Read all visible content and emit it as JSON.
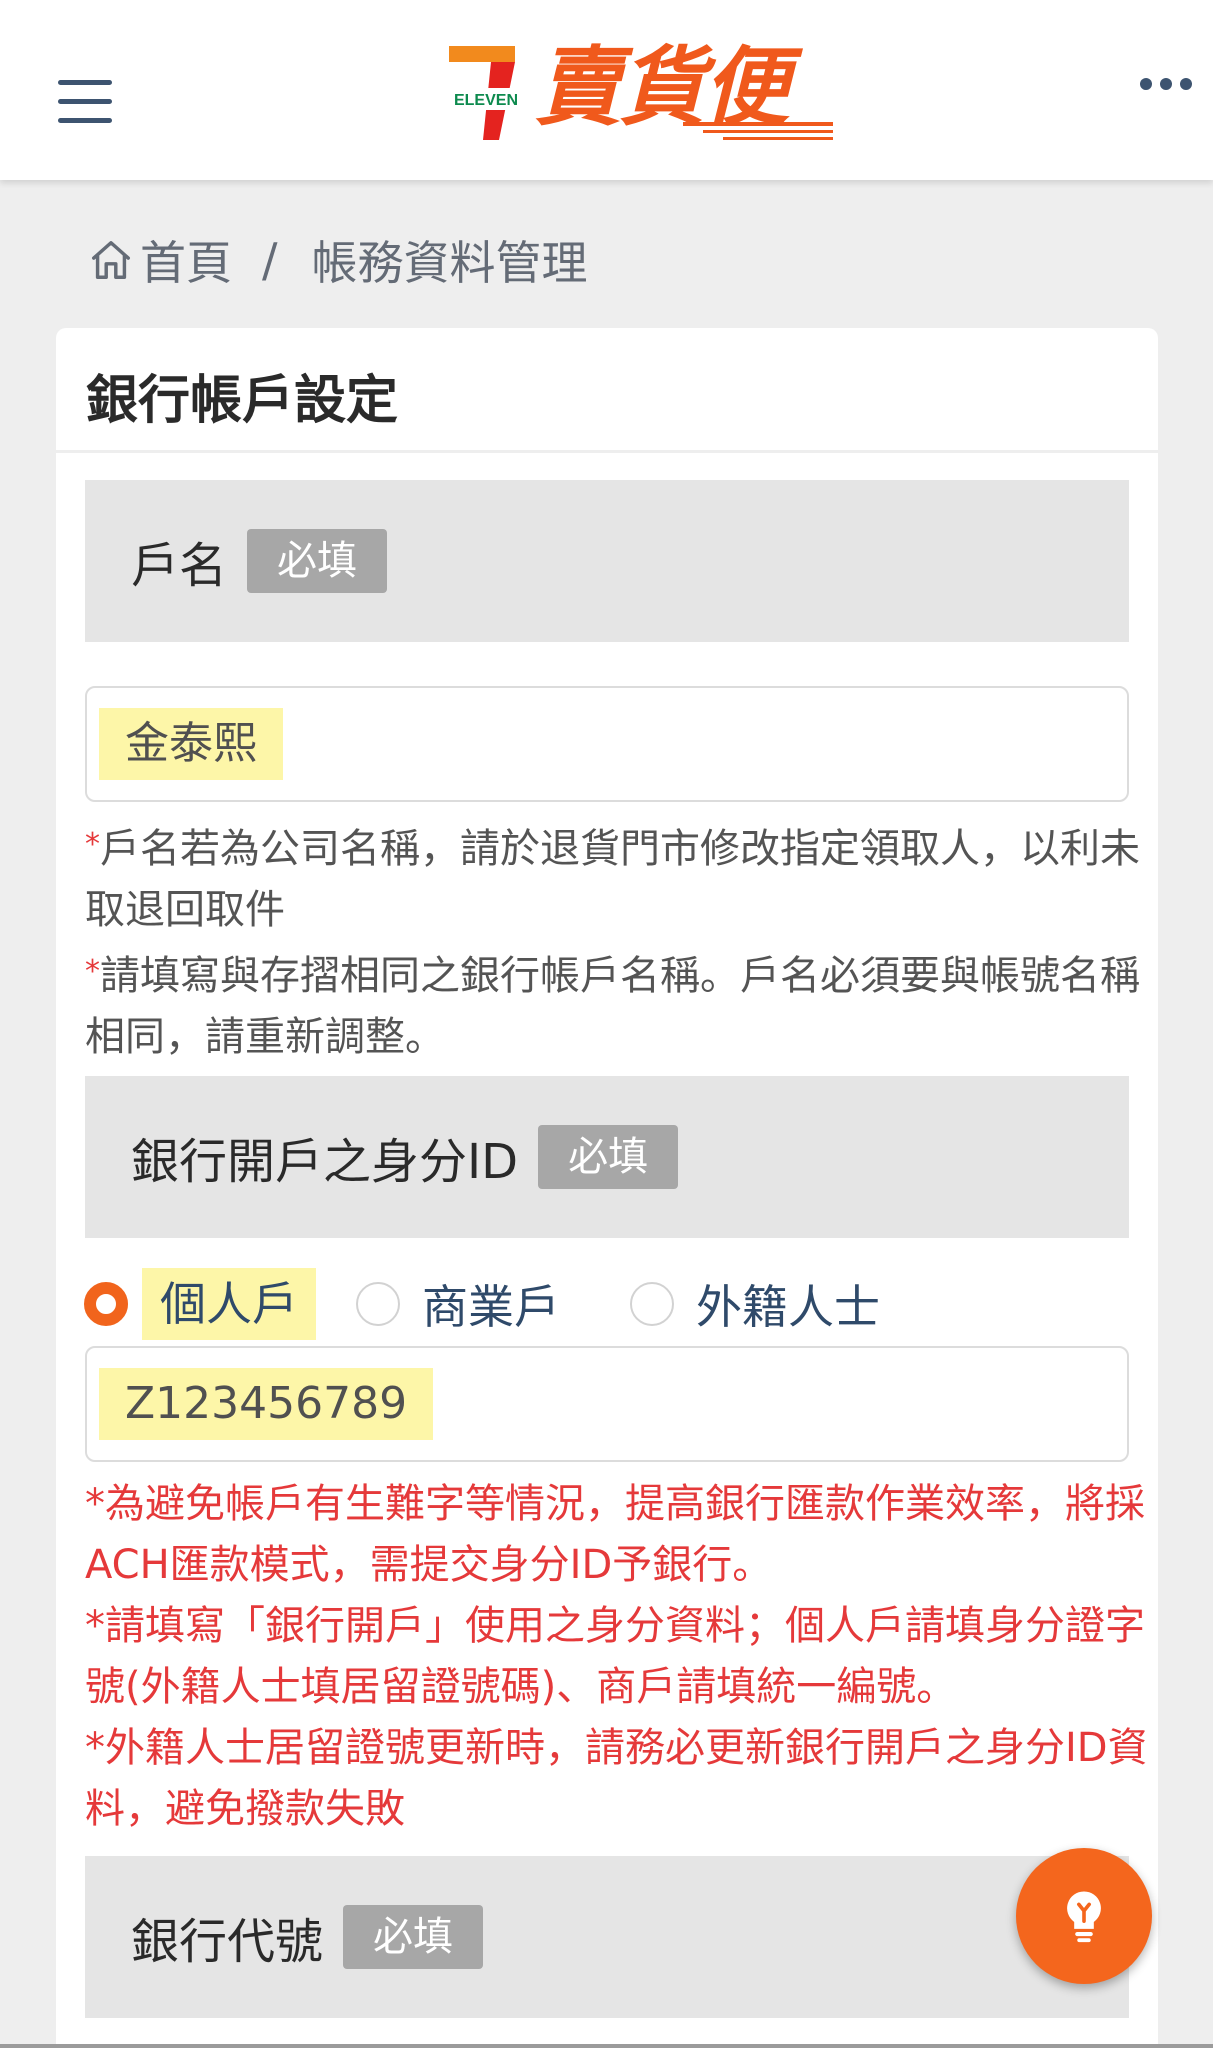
{
  "header": {
    "logo_text": "賣貨便",
    "logo_brand": "ELEVEN",
    "brand_colors": {
      "seven_orange": "#f28a1d",
      "seven_red": "#e4231f",
      "seven_green": "#0d8a4e",
      "logo_text": "#f0591c"
    },
    "menu_icon": "hamburger-menu-icon",
    "more_icon": "more-dots-icon"
  },
  "breadcrumb": {
    "home_icon": "home-icon",
    "home_label": "首頁",
    "separator": "/",
    "current": "帳務資料管理"
  },
  "card": {
    "title": "銀行帳戶設定"
  },
  "account_name": {
    "label": "戶名",
    "required": "必填",
    "value": "金泰熙",
    "note1_star": "*",
    "note1": "戶名若為公司名稱，請於退貨門市修改指定領取人，以利未取退回取件",
    "note2_star": "*",
    "note2": "請填寫與存摺相同之銀行帳戶名稱。戶名必須要與帳號名稱相同，請重新調整。"
  },
  "id_section": {
    "label": "銀行開戶之身分ID",
    "required": "必填",
    "options": [
      {
        "label": "個人戶",
        "checked": true
      },
      {
        "label": "商業戶",
        "checked": false
      },
      {
        "label": "外籍人士",
        "checked": false
      }
    ],
    "value": "Z123456789",
    "note1": "*為避免帳戶有生難字等情況，提高銀行匯款作業效率，將採ACH匯款模式，需提交身分ID予銀行。",
    "note2": "*請填寫「銀行開戶」使用之身分資料；個人戶請填身分證字號(外籍人士填居留證號碼)、商戶請填統一編號。",
    "note3": "*外籍人士居留證號更新時，請務必更新銀行開戶之身分ID資料，避免撥款失敗"
  },
  "bank_code": {
    "label": "銀行代號",
    "required": "必填"
  },
  "fab": {
    "icon": "lightbulb-icon",
    "color": "#f4661d"
  }
}
